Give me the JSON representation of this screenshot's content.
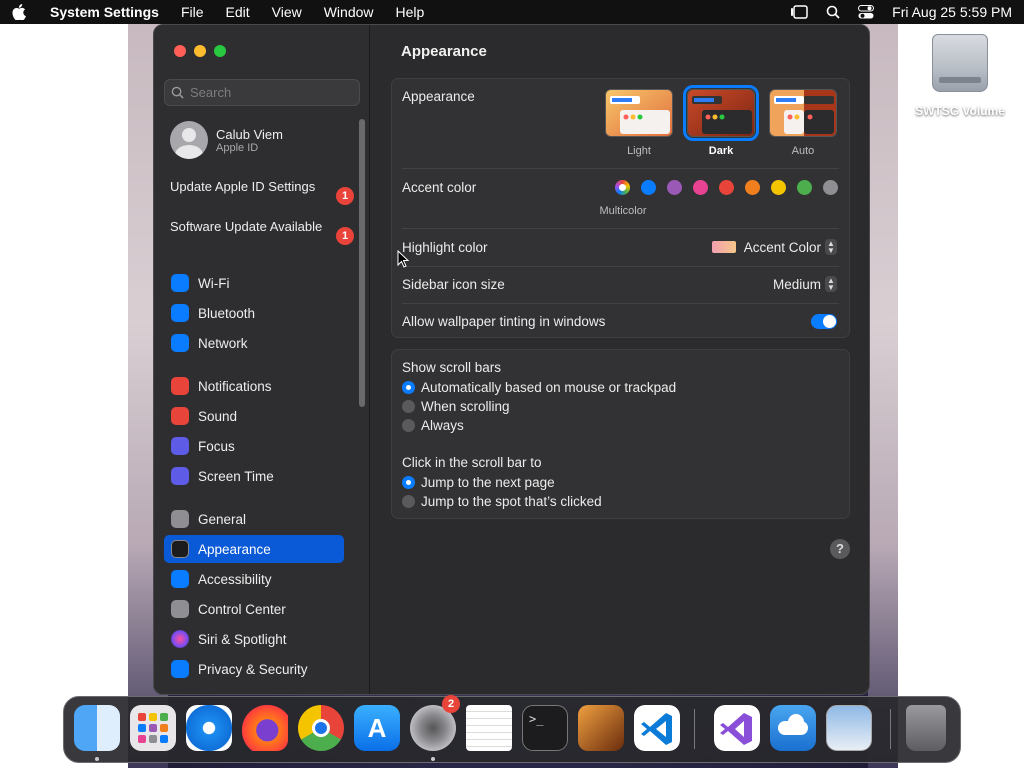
{
  "menubar": {
    "app_name": "System Settings",
    "items": [
      "File",
      "Edit",
      "View",
      "Window",
      "Help"
    ],
    "clock": "Fri Aug 25  5:59 PM"
  },
  "desktop": {
    "volume_label": "SWTSG Volume"
  },
  "sidebar": {
    "search_placeholder": "Search",
    "account": {
      "name": "Calub Viem",
      "subtitle": "Apple ID"
    },
    "alerts": [
      {
        "label": "Update Apple ID Settings",
        "badge": "1"
      },
      {
        "label": "Software Update Available",
        "badge": "1"
      }
    ],
    "items": [
      {
        "label": "Wi-Fi",
        "icon": "wifi-icon",
        "color": "#0a7cff"
      },
      {
        "label": "Bluetooth",
        "icon": "bluetooth-icon",
        "color": "#0a7cff"
      },
      {
        "label": "Network",
        "icon": "network-icon",
        "color": "#0a7cff"
      },
      {
        "label": "Notifications",
        "icon": "bell-icon",
        "color": "#e8443a"
      },
      {
        "label": "Sound",
        "icon": "speaker-icon",
        "color": "#e8443a"
      },
      {
        "label": "Focus",
        "icon": "moon-icon",
        "color": "#5e5ce6"
      },
      {
        "label": "Screen Time",
        "icon": "hourglass-icon",
        "color": "#5e5ce6"
      },
      {
        "label": "General",
        "icon": "gear-icon",
        "color": "#8e8e93"
      },
      {
        "label": "Appearance",
        "icon": "appearance-icon",
        "color": "#1c1c1e"
      },
      {
        "label": "Accessibility",
        "icon": "accessibility-icon",
        "color": "#0a7cff"
      },
      {
        "label": "Control Center",
        "icon": "control-center-icon",
        "color": "#8e8e93"
      },
      {
        "label": "Siri & Spotlight",
        "icon": "siri-icon",
        "color": "#b04ce0"
      },
      {
        "label": "Privacy & Security",
        "icon": "hand-icon",
        "color": "#0a7cff"
      }
    ],
    "selected": "Appearance"
  },
  "content": {
    "title": "Appearance",
    "appearance": {
      "label": "Appearance",
      "options": [
        "Light",
        "Dark",
        "Auto"
      ],
      "selected": "Dark"
    },
    "accent": {
      "label": "Accent color",
      "caption": "Multicolor",
      "colors": [
        "#0a7cff",
        "#9b59b6",
        "#e84393",
        "#e8443a",
        "#f0801e",
        "#f5c400",
        "#4cae4c",
        "#8e8e93"
      ]
    },
    "highlight": {
      "label": "Highlight color",
      "value": "Accent Color"
    },
    "sidebar_icon_size": {
      "label": "Sidebar icon size",
      "value": "Medium"
    },
    "wallpaper_tinting": {
      "label": "Allow wallpaper tinting in windows",
      "enabled": true
    },
    "scroll_bars": {
      "label": "Show scroll bars",
      "options": [
        "Automatically based on mouse or trackpad",
        "When scrolling",
        "Always"
      ],
      "selected": "Automatically based on mouse or trackpad"
    },
    "click_scroll": {
      "label": "Click in the scroll bar to",
      "options": [
        "Jump to the next page",
        "Jump to the spot that’s clicked"
      ],
      "selected": "Jump to the next page"
    },
    "help": "?"
  },
  "dock": {
    "apps": [
      "Finder",
      "Launchpad",
      "Safari",
      "Firefox",
      "Chrome",
      "App Store",
      "System Settings",
      "TextEdit",
      "Terminal",
      "GarageBand",
      "Visual Studio Code",
      "Visual Studio",
      "Weather",
      "Preview",
      "Trash"
    ],
    "settings_badge": "2"
  }
}
